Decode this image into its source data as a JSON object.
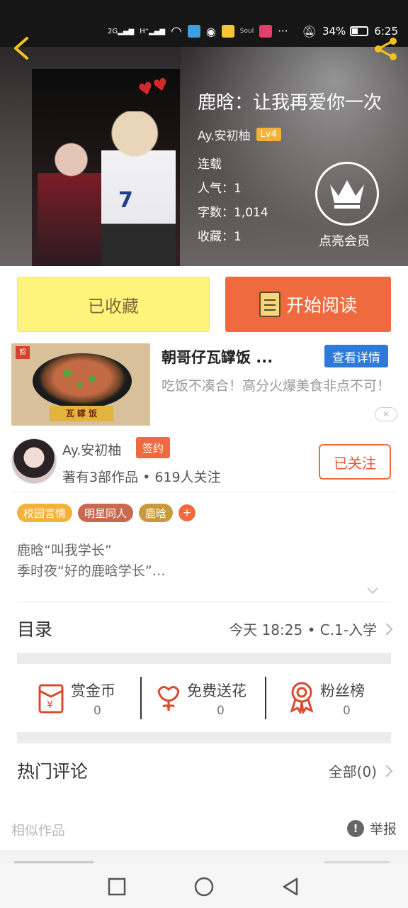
{
  "status_bar": {
    "network_labels": [
      "2G",
      "H⁺"
    ],
    "battery_percent": "34%",
    "time": "6:25",
    "more": "···"
  },
  "book": {
    "title": "鹿晗：让我再爱你一次",
    "author": "Ay.安初柚",
    "level": "Lv4",
    "status": "连载",
    "popularity": "人气：1",
    "word_count": "字数：1,014",
    "favorites": "收藏：1",
    "vip_label": "点亮会员",
    "cover_jersey_number": "7"
  },
  "actions": {
    "collected_label": "已收藏",
    "read_label": "开始阅读"
  },
  "ad": {
    "title": "朝哥仔瓦罉饭 ...",
    "detail_label": "查看详情",
    "description": "吃饭不凑合！高分火爆美食非点不可！",
    "plate_text": "瓦 罉 饭",
    "logo_text": "韶",
    "close_symbol": "✕"
  },
  "author_card": {
    "name": "Ay.安初柚",
    "badge": "签约",
    "meta": "著有3部作品 • 619人关注",
    "follow_label": "已关注"
  },
  "tags": [
    {
      "label": "校园言情",
      "color": "#f5b13a"
    },
    {
      "label": "明星同人",
      "color": "#c96a50"
    },
    {
      "label": "鹿晗",
      "color": "#c99a3b"
    }
  ],
  "tag_more": "+",
  "synopsis": {
    "line1": "鹿晗“叫我学长”",
    "line2": "季时夜“好的鹿晗学长”…"
  },
  "toc": {
    "title": "目录",
    "latest": "今天  18:25   •   C.1-入学"
  },
  "rewards": [
    {
      "label": "赏金币",
      "value": "0",
      "icon": "red-envelope-icon"
    },
    {
      "label": "免费送花",
      "value": "0",
      "icon": "flower-icon"
    },
    {
      "label": "粉丝榜",
      "value": "0",
      "icon": "medal-icon"
    }
  ],
  "comments": {
    "title": "热门评论",
    "all_label": "全部(0)"
  },
  "similar": {
    "title": "相似作品",
    "report_label": "举报"
  },
  "colors": {
    "accent": "#ef6b3f",
    "collected_bg": "#fef47c",
    "ad_button": "#2e7ad8",
    "lv_badge": "#f2b234",
    "reward_icon": "#d94a2e"
  }
}
